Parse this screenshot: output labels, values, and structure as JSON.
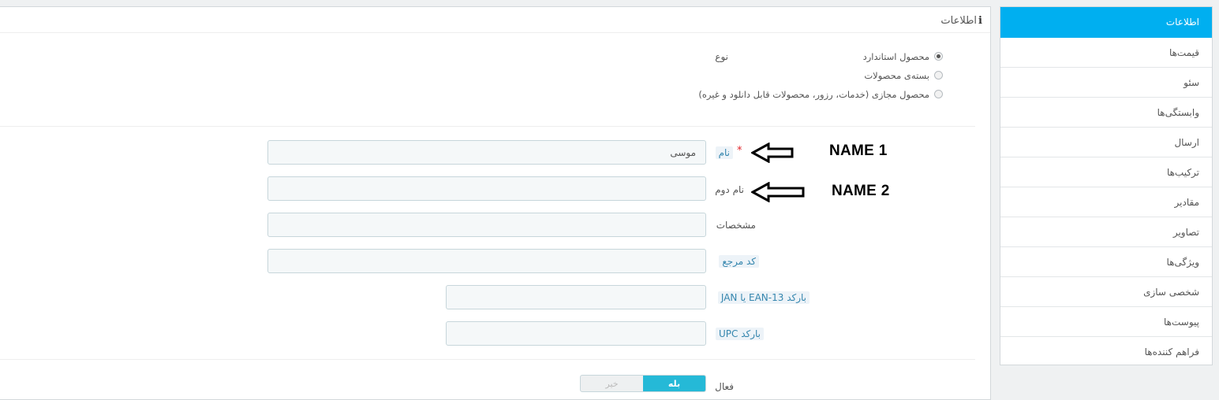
{
  "sidebar": {
    "items": [
      {
        "label": "اطلاعات",
        "active": true
      },
      {
        "label": "قیمت‌ها"
      },
      {
        "label": "سئو"
      },
      {
        "label": "وابستگی‌ها"
      },
      {
        "label": "ارسال"
      },
      {
        "label": "ترکیب‌ها"
      },
      {
        "label": "مقادیر"
      },
      {
        "label": "تصاویر"
      },
      {
        "label": "ویژگی‌ها"
      },
      {
        "label": "شخصی سازی"
      },
      {
        "label": "پیوست‌ها"
      },
      {
        "label": "فراهم کننده‌ها"
      }
    ]
  },
  "panel": {
    "heading": "اطلاعات",
    "type": {
      "label": "نوع",
      "options": [
        {
          "label": "محصول استاندارد",
          "checked": true
        },
        {
          "label": "بسته‌ی محصولات",
          "checked": false
        },
        {
          "label": "محصول مجازی (خدمات، رزور، محصولات قابل دانلود و غیره)",
          "checked": false
        }
      ]
    },
    "fields": {
      "name": {
        "label": "نام",
        "required_mark": "*",
        "value": "موسی"
      },
      "second_name": {
        "label": "نام دوم",
        "value": ""
      },
      "specs": {
        "label": "مشخصات",
        "value": ""
      },
      "reference": {
        "label": "کد مرجع",
        "value": ""
      },
      "ean13": {
        "label": "بارکد EAN-13 یا JAN",
        "value": ""
      },
      "upc": {
        "label": "بارکد UPC",
        "value": ""
      }
    },
    "active": {
      "label": "فعال",
      "yes": "بله",
      "no": "خیر",
      "value": "yes"
    }
  },
  "annotations": {
    "name1": "NAME 1",
    "name2": "NAME 2"
  },
  "colors": {
    "accent": "#00aff0",
    "toggle_on": "#25b9d7",
    "required": "#e0242a",
    "hint_label_text": "#3586ae"
  }
}
